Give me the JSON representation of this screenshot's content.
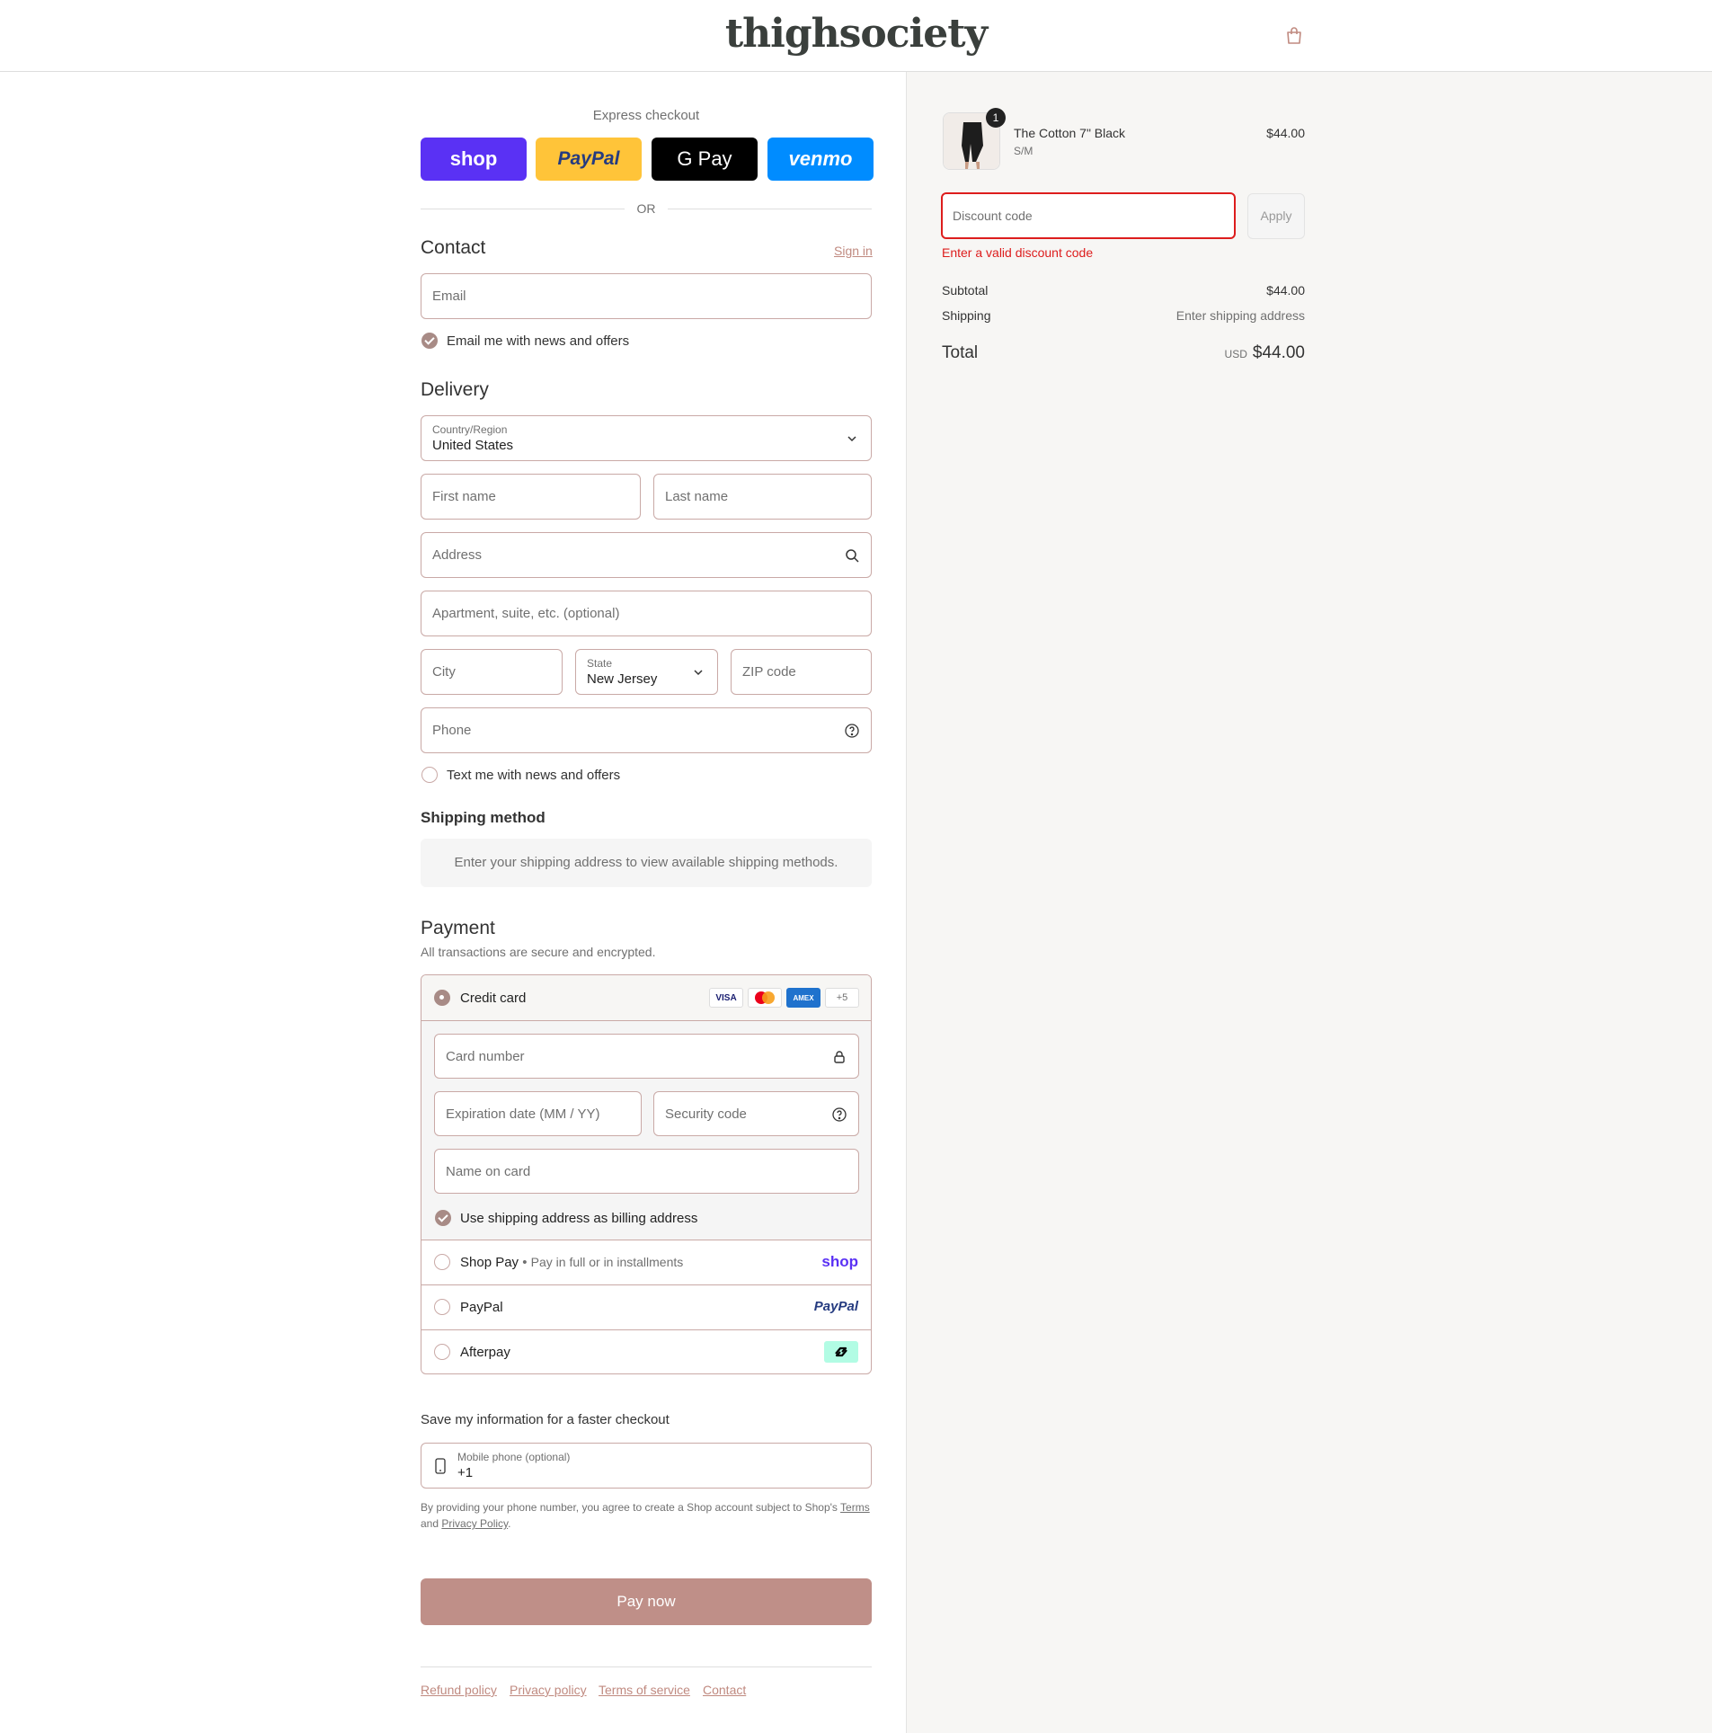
{
  "header": {
    "logo": "thighsociety"
  },
  "express": {
    "title": "Express checkout",
    "buttons": [
      {
        "label": "shop",
        "color": "#5a31f4",
        "text_color": "#ffffff"
      },
      {
        "label": "PayPal",
        "color": "#ffc439",
        "text_color": "#253b80"
      },
      {
        "label": "G Pay",
        "color": "#000000",
        "text_color": "#ffffff"
      },
      {
        "label": "venmo",
        "color": "#008cff",
        "text_color": "#ffffff"
      }
    ],
    "or": "OR"
  },
  "contact": {
    "title": "Contact",
    "sign_in": "Sign in",
    "email_placeholder": "Email",
    "email_opt_in": "Email me with news and offers"
  },
  "delivery": {
    "title": "Delivery",
    "country_label": "Country/Region",
    "country_value": "United States",
    "first_name": "First name",
    "last_name": "Last name",
    "address": "Address",
    "apartment": "Apartment, suite, etc. (optional)",
    "city": "City",
    "state_label": "State",
    "state_value": "New Jersey",
    "zip": "ZIP code",
    "phone": "Phone",
    "text_opt_in": "Text me with news and offers"
  },
  "shipping_method": {
    "title": "Shipping method",
    "message": "Enter your shipping address to view available shipping methods."
  },
  "payment": {
    "title": "Payment",
    "subtitle": "All transactions are secure and encrypted.",
    "credit_card": "Credit card",
    "card_logos": [
      "VISA",
      "MC",
      "AMEX",
      "+5"
    ],
    "card_number": "Card number",
    "expiration": "Expiration date (MM / YY)",
    "security": "Security code",
    "name_on_card": "Name on card",
    "billing_same": "Use shipping address as billing address",
    "shop_pay": "Shop Pay",
    "shop_pay_desc": "Pay in full or in installments",
    "shop_logo": "shop",
    "paypal": "PayPal",
    "paypal_logo": "PayPal",
    "afterpay": "Afterpay"
  },
  "save_info": {
    "title": "Save my information for a faster checkout",
    "mobile_label": "Mobile phone (optional)",
    "mobile_value": "+1",
    "legal_1": "By providing your phone number, you agree to create a Shop account subject to Shop's ",
    "terms": "Terms",
    "legal_2": "and ",
    "privacy": "Privacy Policy",
    "legal_end": "."
  },
  "pay_now": "Pay now",
  "footer_links": [
    "Refund policy",
    "Privacy policy",
    "Terms of service",
    "Contact"
  ],
  "summary": {
    "item_name": "The Cotton 7\" Black",
    "item_variant": "S/M",
    "item_qty": "1",
    "item_price": "$44.00",
    "discount_placeholder": "Discount code",
    "apply": "Apply",
    "discount_error": "Enter a valid discount code",
    "subtotal_label": "Subtotal",
    "subtotal_value": "$44.00",
    "shipping_label": "Shipping",
    "shipping_value": "Enter shipping address",
    "total_label": "Total",
    "currency": "USD",
    "total_value": "$44.00"
  },
  "colors": {
    "accent": "#bf8f88",
    "border": "#c9a9a6",
    "error": "#dd1d1d",
    "summary_bg": "#f7f6f4"
  }
}
